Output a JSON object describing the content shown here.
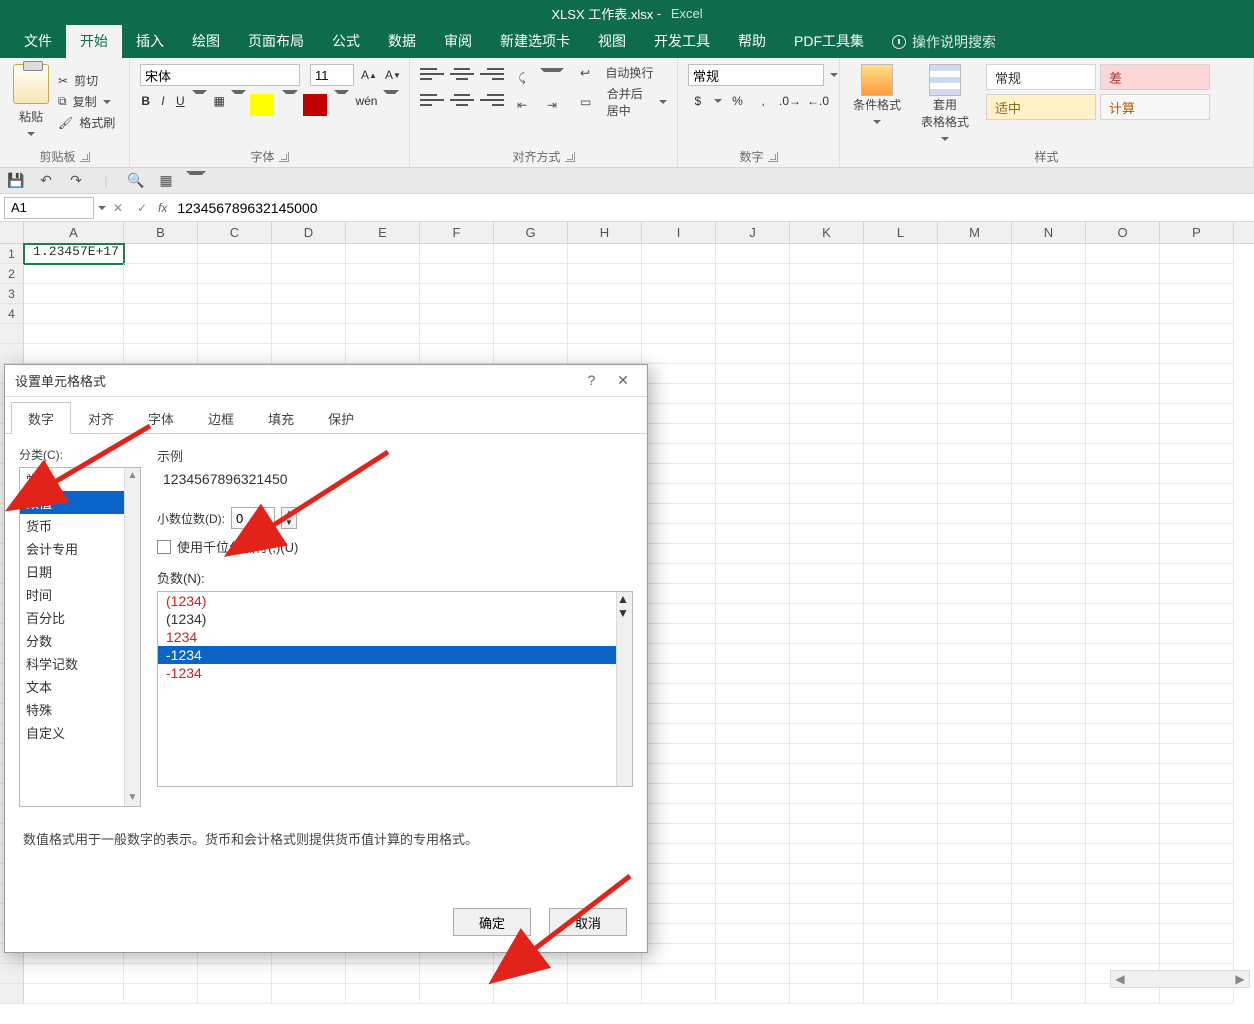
{
  "title": {
    "doc": "XLSX 工作表.xlsx",
    "app": "Excel"
  },
  "tabs": [
    "文件",
    "开始",
    "插入",
    "绘图",
    "页面布局",
    "公式",
    "数据",
    "审阅",
    "新建选项卡",
    "视图",
    "开发工具",
    "帮助",
    "PDF工具集"
  ],
  "tell_me": "操作说明搜索",
  "clipboard": {
    "paste": "粘贴",
    "cut": "剪切",
    "copy": "复制",
    "painter": "格式刷",
    "group": "剪贴板"
  },
  "font": {
    "name": "宋体",
    "size": "11",
    "group": "字体"
  },
  "alignment": {
    "wrap": "自动换行",
    "merge": "合并后居中",
    "group": "对齐方式"
  },
  "number": {
    "format": "常规",
    "group": "数字"
  },
  "styles": {
    "cond": "条件格式",
    "table": "套用\n表格格式",
    "normal": "常规",
    "bad": "差",
    "good": "适中",
    "calc": "计算",
    "group": "样式"
  },
  "name_box": "A1",
  "formula": "123456789632145000",
  "columns": [
    "A",
    "B",
    "C",
    "D",
    "E",
    "F",
    "G",
    "H",
    "I",
    "J",
    "K",
    "L",
    "M",
    "N",
    "O",
    "P"
  ],
  "cell_a1": "1.23457E+17",
  "dialog": {
    "title": "设置单元格格式",
    "tabs": [
      "数字",
      "对齐",
      "字体",
      "边框",
      "填充",
      "保护"
    ],
    "category_label": "分类(C):",
    "categories": [
      "常规",
      "数值",
      "货币",
      "会计专用",
      "日期",
      "时间",
      "百分比",
      "分数",
      "科学记数",
      "文本",
      "特殊",
      "自定义"
    ],
    "selected_category_index": 1,
    "sample_label": "示例",
    "sample_value": "1234567896321450",
    "decimal_label": "小数位数(D):",
    "decimal_value": "0",
    "thousands_label": "使用千位分隔符(,)(U)",
    "negative_label": "负数(N):",
    "negatives": [
      {
        "text": "(1234)",
        "class": "red"
      },
      {
        "text": "(1234)",
        "class": ""
      },
      {
        "text": "1234",
        "class": "red"
      },
      {
        "text": "-1234",
        "class": "sel"
      },
      {
        "text": "-1234",
        "class": "red"
      }
    ],
    "description": "数值格式用于一般数字的表示。货币和会计格式则提供货币值计算的专用格式。",
    "ok": "确定",
    "cancel": "取消"
  }
}
